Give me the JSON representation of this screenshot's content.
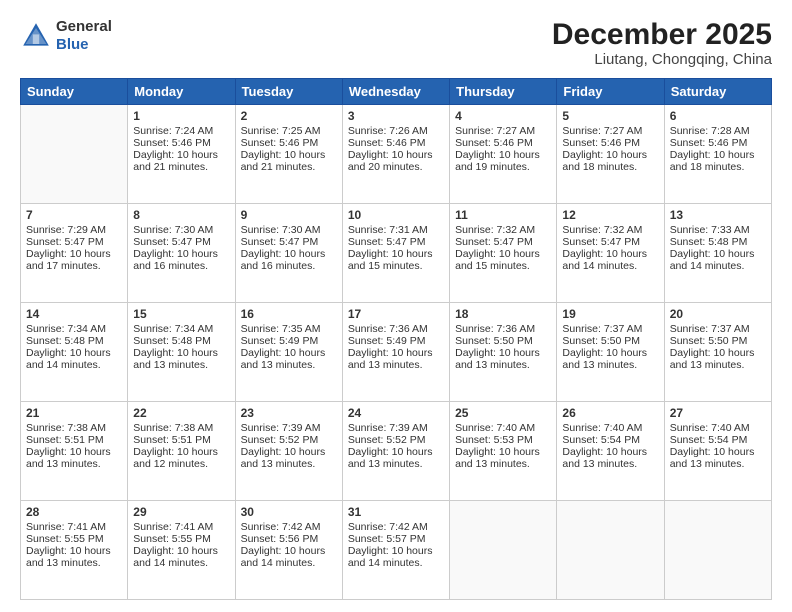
{
  "header": {
    "logo_line1": "General",
    "logo_line2": "Blue",
    "month_title": "December 2025",
    "location": "Liutang, Chongqing, China"
  },
  "days_of_week": [
    "Sunday",
    "Monday",
    "Tuesday",
    "Wednesday",
    "Thursday",
    "Friday",
    "Saturday"
  ],
  "weeks": [
    [
      {
        "day": "",
        "info": ""
      },
      {
        "day": "1",
        "info": "Sunrise: 7:24 AM\nSunset: 5:46 PM\nDaylight: 10 hours\nand 21 minutes."
      },
      {
        "day": "2",
        "info": "Sunrise: 7:25 AM\nSunset: 5:46 PM\nDaylight: 10 hours\nand 21 minutes."
      },
      {
        "day": "3",
        "info": "Sunrise: 7:26 AM\nSunset: 5:46 PM\nDaylight: 10 hours\nand 20 minutes."
      },
      {
        "day": "4",
        "info": "Sunrise: 7:27 AM\nSunset: 5:46 PM\nDaylight: 10 hours\nand 19 minutes."
      },
      {
        "day": "5",
        "info": "Sunrise: 7:27 AM\nSunset: 5:46 PM\nDaylight: 10 hours\nand 18 minutes."
      },
      {
        "day": "6",
        "info": "Sunrise: 7:28 AM\nSunset: 5:46 PM\nDaylight: 10 hours\nand 18 minutes."
      }
    ],
    [
      {
        "day": "7",
        "info": "Sunrise: 7:29 AM\nSunset: 5:47 PM\nDaylight: 10 hours\nand 17 minutes."
      },
      {
        "day": "8",
        "info": "Sunrise: 7:30 AM\nSunset: 5:47 PM\nDaylight: 10 hours\nand 16 minutes."
      },
      {
        "day": "9",
        "info": "Sunrise: 7:30 AM\nSunset: 5:47 PM\nDaylight: 10 hours\nand 16 minutes."
      },
      {
        "day": "10",
        "info": "Sunrise: 7:31 AM\nSunset: 5:47 PM\nDaylight: 10 hours\nand 15 minutes."
      },
      {
        "day": "11",
        "info": "Sunrise: 7:32 AM\nSunset: 5:47 PM\nDaylight: 10 hours\nand 15 minutes."
      },
      {
        "day": "12",
        "info": "Sunrise: 7:32 AM\nSunset: 5:47 PM\nDaylight: 10 hours\nand 14 minutes."
      },
      {
        "day": "13",
        "info": "Sunrise: 7:33 AM\nSunset: 5:48 PM\nDaylight: 10 hours\nand 14 minutes."
      }
    ],
    [
      {
        "day": "14",
        "info": "Sunrise: 7:34 AM\nSunset: 5:48 PM\nDaylight: 10 hours\nand 14 minutes."
      },
      {
        "day": "15",
        "info": "Sunrise: 7:34 AM\nSunset: 5:48 PM\nDaylight: 10 hours\nand 13 minutes."
      },
      {
        "day": "16",
        "info": "Sunrise: 7:35 AM\nSunset: 5:49 PM\nDaylight: 10 hours\nand 13 minutes."
      },
      {
        "day": "17",
        "info": "Sunrise: 7:36 AM\nSunset: 5:49 PM\nDaylight: 10 hours\nand 13 minutes."
      },
      {
        "day": "18",
        "info": "Sunrise: 7:36 AM\nSunset: 5:50 PM\nDaylight: 10 hours\nand 13 minutes."
      },
      {
        "day": "19",
        "info": "Sunrise: 7:37 AM\nSunset: 5:50 PM\nDaylight: 10 hours\nand 13 minutes."
      },
      {
        "day": "20",
        "info": "Sunrise: 7:37 AM\nSunset: 5:50 PM\nDaylight: 10 hours\nand 13 minutes."
      }
    ],
    [
      {
        "day": "21",
        "info": "Sunrise: 7:38 AM\nSunset: 5:51 PM\nDaylight: 10 hours\nand 13 minutes."
      },
      {
        "day": "22",
        "info": "Sunrise: 7:38 AM\nSunset: 5:51 PM\nDaylight: 10 hours\nand 12 minutes."
      },
      {
        "day": "23",
        "info": "Sunrise: 7:39 AM\nSunset: 5:52 PM\nDaylight: 10 hours\nand 13 minutes."
      },
      {
        "day": "24",
        "info": "Sunrise: 7:39 AM\nSunset: 5:52 PM\nDaylight: 10 hours\nand 13 minutes."
      },
      {
        "day": "25",
        "info": "Sunrise: 7:40 AM\nSunset: 5:53 PM\nDaylight: 10 hours\nand 13 minutes."
      },
      {
        "day": "26",
        "info": "Sunrise: 7:40 AM\nSunset: 5:54 PM\nDaylight: 10 hours\nand 13 minutes."
      },
      {
        "day": "27",
        "info": "Sunrise: 7:40 AM\nSunset: 5:54 PM\nDaylight: 10 hours\nand 13 minutes."
      }
    ],
    [
      {
        "day": "28",
        "info": "Sunrise: 7:41 AM\nSunset: 5:55 PM\nDaylight: 10 hours\nand 13 minutes."
      },
      {
        "day": "29",
        "info": "Sunrise: 7:41 AM\nSunset: 5:55 PM\nDaylight: 10 hours\nand 14 minutes."
      },
      {
        "day": "30",
        "info": "Sunrise: 7:42 AM\nSunset: 5:56 PM\nDaylight: 10 hours\nand 14 minutes."
      },
      {
        "day": "31",
        "info": "Sunrise: 7:42 AM\nSunset: 5:57 PM\nDaylight: 10 hours\nand 14 minutes."
      },
      {
        "day": "",
        "info": ""
      },
      {
        "day": "",
        "info": ""
      },
      {
        "day": "",
        "info": ""
      }
    ]
  ]
}
